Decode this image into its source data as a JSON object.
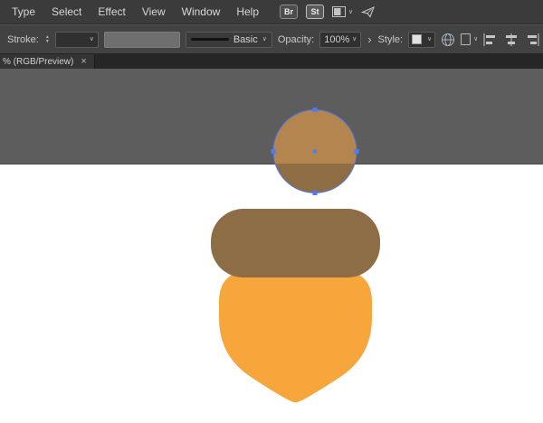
{
  "menubar": {
    "items": [
      "Type",
      "Select",
      "Effect",
      "View",
      "Window",
      "Help"
    ],
    "bridge_badge": "Br",
    "stock_badge": "St"
  },
  "controlbar": {
    "stroke_label": "Stroke:",
    "brush_label": "Basic",
    "opacity_label": "Opacity:",
    "opacity_value": "100%",
    "style_label": "Style:"
  },
  "tabbar": {
    "title": "% (RGB/Preview)"
  },
  "icons": {
    "chevron_down": "∨",
    "chevron_right": "›",
    "close": "×",
    "step_up": "▲",
    "step_down": "▼"
  },
  "canvas": {
    "colors": {
      "pasteboard": "#5d5d5d",
      "artboard": "#ffffff",
      "boundary_line": "#474747",
      "acorn_circle_top": "#b4854e",
      "acorn_circle_bottom": "#8e6c44",
      "acorn_cap": "#8c6d46",
      "acorn_body": "#f6a63b",
      "selection": "#4b7cf3"
    }
  }
}
